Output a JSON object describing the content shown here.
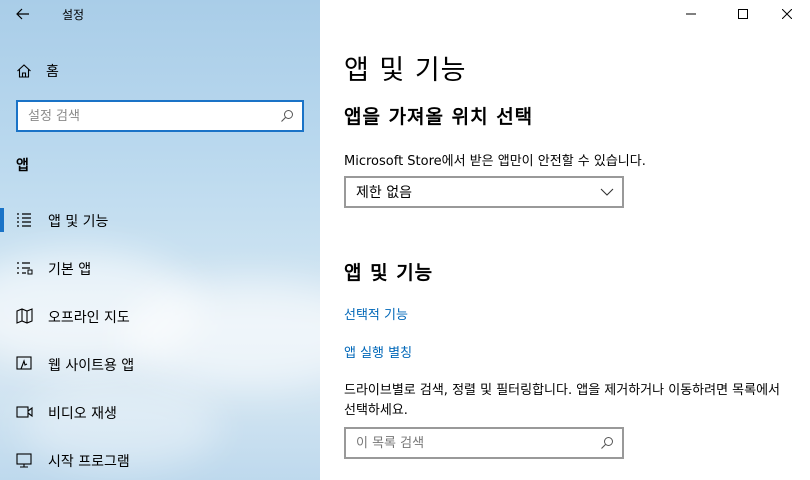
{
  "app": {
    "title": "설정"
  },
  "sidebar": {
    "home_label": "홈",
    "search_placeholder": "설정 검색",
    "section_heading": "앱",
    "items": [
      {
        "label": "앱 및 기능",
        "icon": "list-icon",
        "active": true
      },
      {
        "label": "기본 앱",
        "icon": "default-apps-icon",
        "active": false
      },
      {
        "label": "오프라인 지도",
        "icon": "map-icon",
        "active": false
      },
      {
        "label": "웹 사이트용 앱",
        "icon": "website-apps-icon",
        "active": false
      },
      {
        "label": "비디오 재생",
        "icon": "video-icon",
        "active": false
      },
      {
        "label": "시작 프로그램",
        "icon": "startup-icon",
        "active": false
      }
    ]
  },
  "main": {
    "page_title": "앱 및 기능",
    "install_section": {
      "title": "앱을 가져올 위치 선택",
      "description": "Microsoft Store에서 받은 앱만이 안전할 수 있습니다.",
      "dropdown_value": "제한 없음"
    },
    "apps_section": {
      "title": "앱 및 기능",
      "link_optional": "선택적 기능",
      "link_aliases": "앱 실행 별칭",
      "description": "드라이브별로 검색, 정렬 및 필터링합니다. 앱을 제거하거나 이동하려면 목록에서 선택하세요.",
      "search_placeholder": "이 목록 검색"
    }
  },
  "colors": {
    "accent": "#1a73c7",
    "link": "#0067b8"
  }
}
